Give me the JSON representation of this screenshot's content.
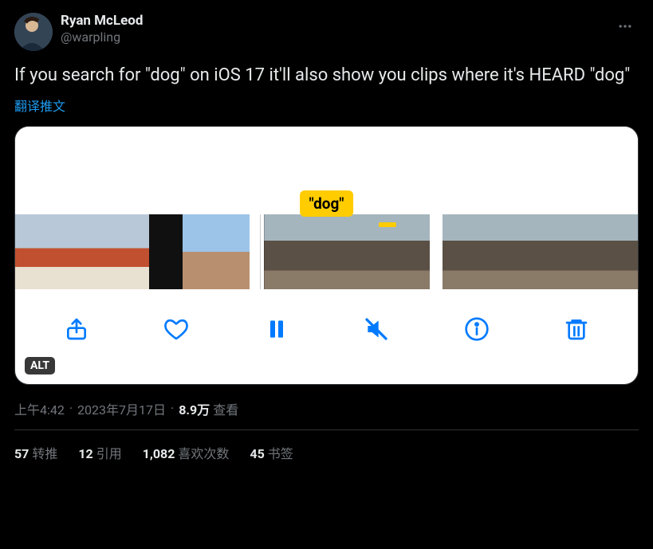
{
  "author": {
    "display_name": "Ryan McLeod",
    "handle": "@warpling"
  },
  "body_text": "If you search for \"dog\" on iOS 17 it'll also show you clips where it's HEARD \"dog\"",
  "translate_label": "翻译推文",
  "media": {
    "caption_pill": "\"dog\"",
    "alt_badge": "ALT"
  },
  "meta": {
    "time": "上午4:42",
    "date": "2023年7月17日",
    "views_count": "8.9万",
    "views_label": "查看"
  },
  "stats": {
    "retweets": {
      "count": "57",
      "label": "转推"
    },
    "quotes": {
      "count": "12",
      "label": "引用"
    },
    "likes": {
      "count": "1,082",
      "label": "喜欢次数"
    },
    "bookmarks": {
      "count": "45",
      "label": "书签"
    }
  }
}
